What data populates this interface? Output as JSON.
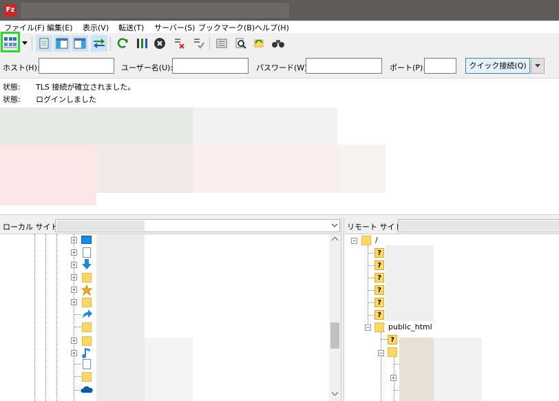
{
  "app": {
    "icon_label": "Fz"
  },
  "menu": [
    "ファイル(F)",
    "編集(E)",
    "表示(V)",
    "転送(T)",
    "サーバー(S)",
    "ブックマーク(B)",
    "ヘルプ(H)"
  ],
  "quickconnect": {
    "host_label": "ホスト(H):",
    "user_label": "ユーザー名(U):",
    "pass_label": "パスワード(W):",
    "port_label": "ポート(P):",
    "host_value": "",
    "user_value": "",
    "pass_value": "",
    "port_value": "",
    "button_label": "クイック接続(Q)"
  },
  "log": [
    {
      "key": "状態:",
      "text": "TLS 接続が確立されました。"
    },
    {
      "key": "状態:",
      "text": "ログインしました"
    }
  ],
  "local": {
    "label": "ローカル サイト:",
    "path": ""
  },
  "remote": {
    "label": "リモート サイト:",
    "path": "",
    "root_label": "/",
    "public_html_label": "public_html"
  },
  "icons": {
    "site_manager": "site-manager-icon",
    "toggle_log": "message-log-icon",
    "toggle_local": "local-tree-icon",
    "toggle_remote": "remote-tree-icon",
    "toggle_queue": "transfer-queue-icon",
    "refresh": "refresh-icon",
    "filters": "filter-icon",
    "cancel": "cancel-icon",
    "disconnect": "disconnect-icon",
    "reconnect": "reconnect-icon",
    "dir_compare": "directory-listing-icon",
    "search": "search-icon",
    "sync": "sync-browse-icon",
    "find": "binoculars-icon"
  }
}
